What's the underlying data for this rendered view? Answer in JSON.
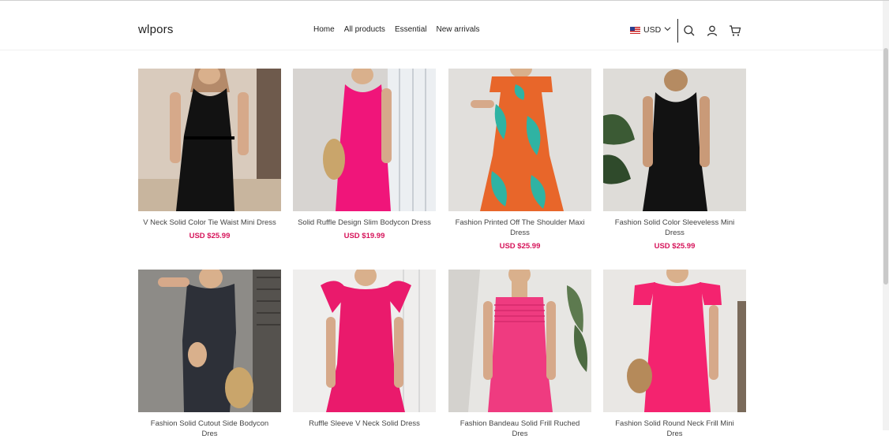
{
  "header": {
    "logo": "wlpors",
    "nav": [
      "Home",
      "All products",
      "Essential",
      "New arrivals"
    ],
    "currency": "USD",
    "icons": [
      "search-icon",
      "account-icon",
      "cart-icon"
    ]
  },
  "colors": {
    "price": "#d6145a",
    "accent_pink": "#e8176a",
    "black_dress": "#121212"
  },
  "products": [
    {
      "title": "V Neck Solid Color Tie Waist Mini Dress",
      "price": "USD $25.99",
      "dress_color": "#121212"
    },
    {
      "title": "Solid Ruffle Design Slim Bodycon Dress",
      "price": "USD $19.99",
      "dress_color": "#f0157a"
    },
    {
      "title": "Fashion Printed Off The Shoulder Maxi Dress",
      "price": "USD $25.99",
      "dress_color": "#e8662a"
    },
    {
      "title": "Fashion Solid Color Sleeveless Mini Dress",
      "price": "USD $25.99",
      "dress_color": "#121212"
    },
    {
      "title": "Fashion Solid Cutout Side Bodycon Dres",
      "price": "",
      "dress_color": "#2d3038"
    },
    {
      "title": "Ruffle Sleeve V Neck Solid Dress",
      "price": "",
      "dress_color": "#ea1a6c"
    },
    {
      "title": "Fashion Bandeau Solid Frill Ruched Dres",
      "price": "",
      "dress_color": "#ef3b80"
    },
    {
      "title": "Fashion Solid Round Neck Frill Mini Dres",
      "price": "",
      "dress_color": "#f4236f"
    }
  ]
}
